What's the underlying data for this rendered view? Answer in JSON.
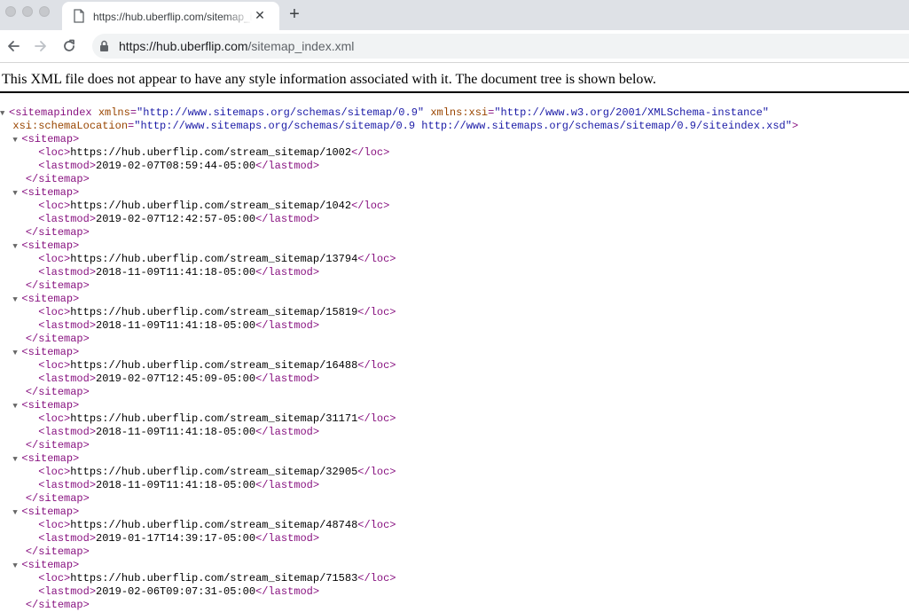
{
  "browser": {
    "tab": {
      "title": "https://hub.uberflip.com/sitemap_index.xml",
      "close_glyph": "✕",
      "icon": "document-icon"
    },
    "new_tab_glyph": "+",
    "address": {
      "host": "https://hub.uberflip.com",
      "path": "/sitemap_index.xml",
      "icon": "lock-icon"
    }
  },
  "page": {
    "notice": "This XML file does not appear to have any style information associated with it. The document tree is shown below.",
    "root": {
      "tag": "sitemapindex",
      "xmlns": "http://www.sitemaps.org/schemas/sitemap/0.9",
      "xmlns_xsi": "http://www.w3.org/2001/XMLSchema-instance",
      "schemaLocation": "http://www.sitemaps.org/schemas/sitemap/0.9 http://www.sitemaps.org/schemas/sitemap/0.9/siteindex.xsd"
    },
    "sitemaps": [
      {
        "loc": "https://hub.uberflip.com/stream_sitemap/1002",
        "lastmod": "2019-02-07T08:59:44-05:00"
      },
      {
        "loc": "https://hub.uberflip.com/stream_sitemap/1042",
        "lastmod": "2019-02-07T12:42:57-05:00"
      },
      {
        "loc": "https://hub.uberflip.com/stream_sitemap/13794",
        "lastmod": "2018-11-09T11:41:18-05:00"
      },
      {
        "loc": "https://hub.uberflip.com/stream_sitemap/15819",
        "lastmod": "2018-11-09T11:41:18-05:00"
      },
      {
        "loc": "https://hub.uberflip.com/stream_sitemap/16488",
        "lastmod": "2019-02-07T12:45:09-05:00"
      },
      {
        "loc": "https://hub.uberflip.com/stream_sitemap/31171",
        "lastmod": "2018-11-09T11:41:18-05:00"
      },
      {
        "loc": "https://hub.uberflip.com/stream_sitemap/32905",
        "lastmod": "2018-11-09T11:41:18-05:00"
      },
      {
        "loc": "https://hub.uberflip.com/stream_sitemap/48748",
        "lastmod": "2019-01-17T14:39:17-05:00"
      },
      {
        "loc": "https://hub.uberflip.com/stream_sitemap/71583",
        "lastmod": "2019-02-06T09:07:31-05:00"
      }
    ]
  },
  "colors": {
    "tag": "#881280",
    "attribute": "#994500",
    "value": "#1a1aa6",
    "tabstrip": "#dee1e6"
  }
}
